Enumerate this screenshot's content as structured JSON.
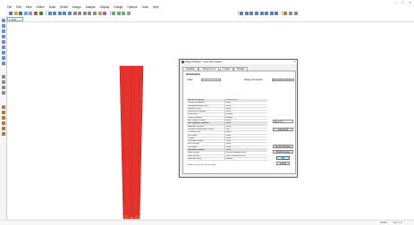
{
  "menu": [
    "File",
    "Edit",
    "View",
    "Define",
    "Draw",
    "Select",
    "Assign",
    "Analyze",
    "Display",
    "Design",
    "Options",
    "Tools",
    "Help"
  ],
  "view_tab": "3-D View",
  "dialog": {
    "title": "Object Model - Line Information",
    "tabs": [
      "Location",
      "Assignments",
      "Loads",
      "Design"
    ],
    "active_tab": "Assignments",
    "section_label": "Identification",
    "label_field_label": "Label",
    "label_value": "",
    "design_procedure_label": "Design Procedure",
    "design_procedure_value": "Steel Frame Design",
    "rows": [
      {
        "k": "Section Property",
        "v": "PIPE-6X.375"
      },
      {
        "k": "Property Modifiers",
        "v": "None"
      },
      {
        "k": "Releases/Partial Fixity",
        "v": "None"
      },
      {
        "k": "Insertion Point",
        "v": "None"
      },
      {
        "k": "Frame Line Springs",
        "v": "None"
      },
      {
        "k": "Local Axes",
        "v": "Default"
      },
      {
        "k": "Output Stations",
        "v": "Default"
      },
      {
        "k": "End Length Offsets",
        "v": "None"
      },
      {
        "k": "Min. Number Stations",
        "v": "None"
      },
      {
        "k": "Material Overwrite",
        "v": "None"
      },
      {
        "k": "Tension/Compression Limits",
        "v": "Yes"
      },
      {
        "k": "P-Delta Force",
        "v": "None"
      },
      {
        "k": "Line Mass",
        "v": "None"
      },
      {
        "k": "Hinges",
        "v": "None"
      },
      {
        "k": "Nonlinear Weight",
        "v": "None"
      },
      {
        "k": "Line Springs",
        "v": "None"
      },
      {
        "k": "Line Mass",
        "v": "None"
      },
      {
        "k": "Automesh Model",
        "v": "None"
      },
      {
        "k": "Mesh Option",
        "v": "At Intermediate Joints"
      },
      {
        "k": "Mesh Length",
        "v": "Use Intersections, 12"
      },
      {
        "k": "Material Group",
        "v": "Default"
      }
    ],
    "note": "Double click on the row to modify",
    "side_dropdown": "Steel Int. +",
    "side_button": "Advanced",
    "buttons": [
      "Section Property",
      "Modify Display",
      "OK",
      "Cancel"
    ]
  },
  "statusbar": {
    "left": "",
    "right_1": "Global",
    "right_2": "Kip, ft, F"
  },
  "colors": {
    "member_fill": "#e5332e",
    "member_edge": "#b8201c",
    "dialog_accent": "#2c6fbf"
  }
}
